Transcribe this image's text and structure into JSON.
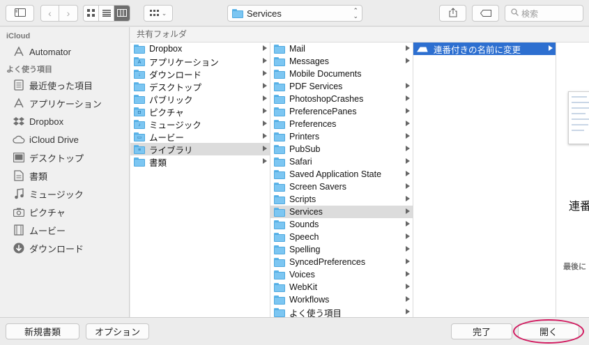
{
  "toolbar": {
    "path_label": "Services",
    "search_placeholder": "検索"
  },
  "sidebar": {
    "sections": [
      {
        "title": "iCloud",
        "items": [
          {
            "label": "Automator",
            "icon": "automator-icon"
          }
        ]
      },
      {
        "title": "よく使う項目",
        "items": [
          {
            "label": "最近使った項目",
            "icon": "recents-icon"
          },
          {
            "label": "アプリケーション",
            "icon": "applications-icon"
          },
          {
            "label": "Dropbox",
            "icon": "dropbox-icon"
          },
          {
            "label": "iCloud Drive",
            "icon": "cloud-icon"
          },
          {
            "label": "デスクトップ",
            "icon": "desktop-icon"
          },
          {
            "label": "書類",
            "icon": "documents-icon"
          },
          {
            "label": "ミュージック",
            "icon": "music-icon"
          },
          {
            "label": "ピクチャ",
            "icon": "camera-icon"
          },
          {
            "label": "ムービー",
            "icon": "film-icon"
          },
          {
            "label": "ダウンロード",
            "icon": "download-icon"
          }
        ]
      }
    ]
  },
  "browser": {
    "header": "共有フォルダ",
    "col1": [
      {
        "label": "Dropbox",
        "badge": "",
        "arrow": true
      },
      {
        "label": "アプリケーション",
        "badge": "A",
        "arrow": true
      },
      {
        "label": "ダウンロード",
        "badge": "↓",
        "arrow": true
      },
      {
        "label": "デスクトップ",
        "badge": "",
        "arrow": true
      },
      {
        "label": "パブリック",
        "badge": "",
        "arrow": true
      },
      {
        "label": "ピクチャ",
        "badge": "◘",
        "arrow": true
      },
      {
        "label": "ミュージック",
        "badge": "♪",
        "arrow": true
      },
      {
        "label": "ムービー",
        "badge": "▭",
        "arrow": true
      },
      {
        "label": "ライブラリ",
        "badge": "≡",
        "arrow": true,
        "selected": true
      },
      {
        "label": "書類",
        "badge": "",
        "arrow": true
      }
    ],
    "col2": [
      {
        "label": "Mail",
        "arrow": true
      },
      {
        "label": "Messages",
        "arrow": true
      },
      {
        "label": "Mobile Documents",
        "arrow": false
      },
      {
        "label": "PDF Services",
        "arrow": true
      },
      {
        "label": "PhotoshopCrashes",
        "arrow": true
      },
      {
        "label": "PreferencePanes",
        "arrow": true
      },
      {
        "label": "Preferences",
        "arrow": true
      },
      {
        "label": "Printers",
        "arrow": true
      },
      {
        "label": "PubSub",
        "arrow": true
      },
      {
        "label": "Safari",
        "arrow": true
      },
      {
        "label": "Saved Application State",
        "arrow": true
      },
      {
        "label": "Screen Savers",
        "arrow": true
      },
      {
        "label": "Scripts",
        "arrow": true
      },
      {
        "label": "Services",
        "arrow": true,
        "selected": true
      },
      {
        "label": "Sounds",
        "arrow": true
      },
      {
        "label": "Speech",
        "arrow": true
      },
      {
        "label": "Spelling",
        "arrow": true
      },
      {
        "label": "SyncedPreferences",
        "arrow": true
      },
      {
        "label": "Voices",
        "arrow": true
      },
      {
        "label": "WebKit",
        "arrow": true
      },
      {
        "label": "Workflows",
        "arrow": true
      },
      {
        "label": "よく使う項目",
        "arrow": true
      }
    ],
    "col3": [
      {
        "label": "連番付きの名前に変更",
        "arrow": true,
        "selected": true
      }
    ]
  },
  "preview": {
    "title": "連番",
    "meta": "最後に"
  },
  "footer": {
    "new_folder": "新規書類",
    "options": "オプション",
    "done": "完了",
    "open": "開く"
  }
}
